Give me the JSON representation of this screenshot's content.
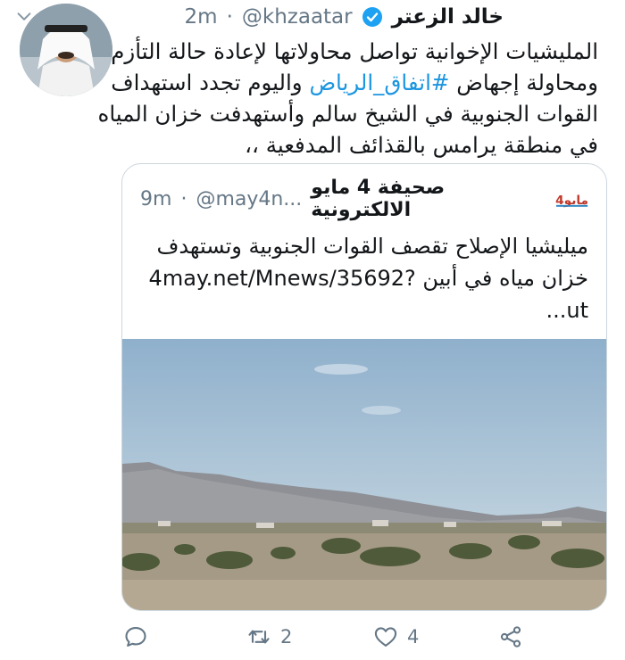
{
  "tweet": {
    "author_name": "خالد الزعتر",
    "handle": "@khzaatar",
    "separator": "·",
    "time": "2m",
    "text_lines": [
      "المليشيات الإخوانية تواصل محاولاتها لإعادة حالة التأزم",
      "ومحاولة إجهاض",
      "#اتفاق_الرياض",
      "واليوم تجدد استهداف",
      "القوات الجنوبية في الشيخ سالم وأستهدفت خزان المياه",
      "في منطقة يرامس بالقذائف المدفعية ،،"
    ]
  },
  "quoted": {
    "name": "صحيفة 4 مايو الالكترونية",
    "logo_text": "4مايو",
    "handle": "@may4n...",
    "separator": "·",
    "time": "9m",
    "line1": "ميليشيا الإصلاح تقصف القوات الجنوبية وتستهدف",
    "line2_ar": "خزان مياه في أبين",
    "line2_link": "4may.net/Mnews/35692?",
    "line3": "ut..."
  },
  "actions": {
    "reply_count": "",
    "retweet_count": "2",
    "like_count": "4"
  },
  "colors": {
    "link": "#1b95e0",
    "text": "#14171a",
    "muted": "#657786",
    "border": "#ccd6dd"
  },
  "icons": [
    "verified-badge-icon",
    "chevron-down-icon",
    "reply-icon",
    "retweet-icon",
    "like-icon",
    "share-icon"
  ]
}
